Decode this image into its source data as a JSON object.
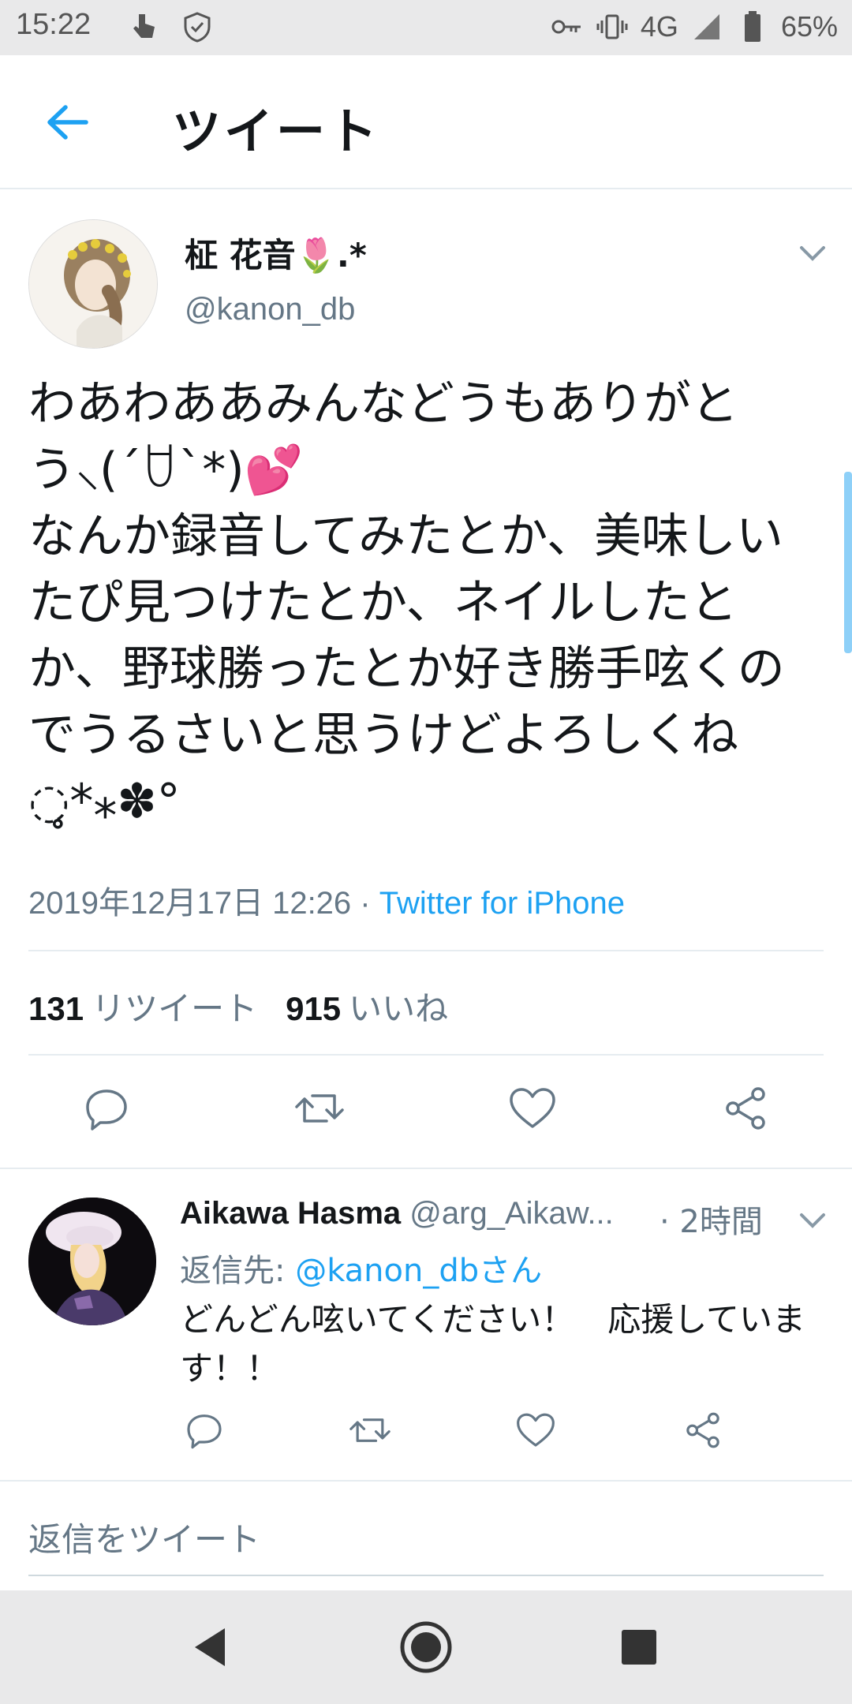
{
  "status_bar": {
    "time": "15:22",
    "network": "4G",
    "battery": "65%"
  },
  "header": {
    "title": "ツイート"
  },
  "tweet": {
    "author_name": "柾 花音🌷.*",
    "author_handle": "@kanon_db",
    "text": "わあわああみんなどうもありがとう⸜(´ꇴ`*)💕\nなんか録音してみたとか、美味しいたぴ見つけたとか、ネイルしたとか、野球勝ったとか好き勝手呟くのでうるさいと思うけどよろしくね◌̥*⁎✽°",
    "timestamp": "2019年12月17日 12:26 · ",
    "source": "Twitter for iPhone",
    "retweets_count": "131",
    "retweets_label": "リツイート",
    "likes_count": "915",
    "likes_label": "いいね"
  },
  "reply": {
    "author_name": "Aikawa Hasma",
    "author_handle": "@arg_Aikaw...",
    "time": "· 2時間",
    "reply_to_prefix": "返信先: ",
    "reply_to_mention": "@kanon_dbさん",
    "text": "どんどん呟いてください！　応援しています！！"
  },
  "compose": {
    "placeholder": "返信をツイート"
  },
  "colors": {
    "accent": "#1da1f2",
    "secondary_text": "#657786",
    "divider": "#e6ecf0"
  }
}
